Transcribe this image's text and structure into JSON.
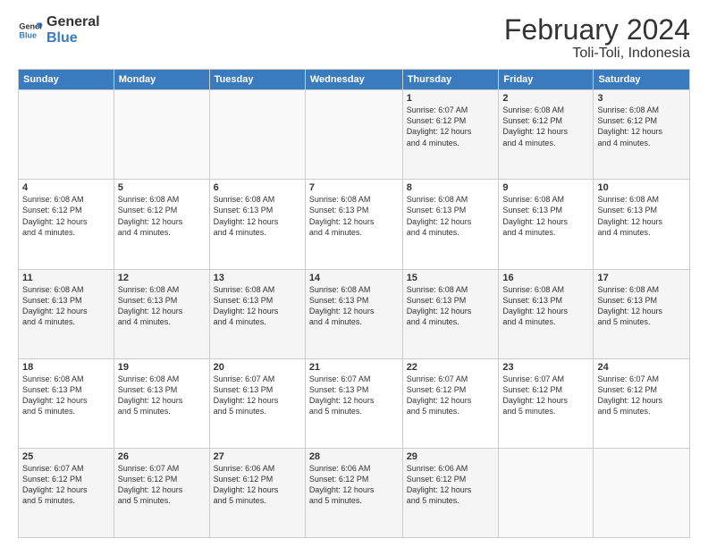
{
  "logo": {
    "line1": "General",
    "line2": "Blue"
  },
  "title": "February 2024",
  "subtitle": "Toli-Toli, Indonesia",
  "header_days": [
    "Sunday",
    "Monday",
    "Tuesday",
    "Wednesday",
    "Thursday",
    "Friday",
    "Saturday"
  ],
  "weeks": [
    [
      {
        "day": "",
        "info": ""
      },
      {
        "day": "",
        "info": ""
      },
      {
        "day": "",
        "info": ""
      },
      {
        "day": "",
        "info": ""
      },
      {
        "day": "1",
        "info": "Sunrise: 6:07 AM\nSunset: 6:12 PM\nDaylight: 12 hours\nand 4 minutes."
      },
      {
        "day": "2",
        "info": "Sunrise: 6:08 AM\nSunset: 6:12 PM\nDaylight: 12 hours\nand 4 minutes."
      },
      {
        "day": "3",
        "info": "Sunrise: 6:08 AM\nSunset: 6:12 PM\nDaylight: 12 hours\nand 4 minutes."
      }
    ],
    [
      {
        "day": "4",
        "info": "Sunrise: 6:08 AM\nSunset: 6:12 PM\nDaylight: 12 hours\nand 4 minutes."
      },
      {
        "day": "5",
        "info": "Sunrise: 6:08 AM\nSunset: 6:12 PM\nDaylight: 12 hours\nand 4 minutes."
      },
      {
        "day": "6",
        "info": "Sunrise: 6:08 AM\nSunset: 6:13 PM\nDaylight: 12 hours\nand 4 minutes."
      },
      {
        "day": "7",
        "info": "Sunrise: 6:08 AM\nSunset: 6:13 PM\nDaylight: 12 hours\nand 4 minutes."
      },
      {
        "day": "8",
        "info": "Sunrise: 6:08 AM\nSunset: 6:13 PM\nDaylight: 12 hours\nand 4 minutes."
      },
      {
        "day": "9",
        "info": "Sunrise: 6:08 AM\nSunset: 6:13 PM\nDaylight: 12 hours\nand 4 minutes."
      },
      {
        "day": "10",
        "info": "Sunrise: 6:08 AM\nSunset: 6:13 PM\nDaylight: 12 hours\nand 4 minutes."
      }
    ],
    [
      {
        "day": "11",
        "info": "Sunrise: 6:08 AM\nSunset: 6:13 PM\nDaylight: 12 hours\nand 4 minutes."
      },
      {
        "day": "12",
        "info": "Sunrise: 6:08 AM\nSunset: 6:13 PM\nDaylight: 12 hours\nand 4 minutes."
      },
      {
        "day": "13",
        "info": "Sunrise: 6:08 AM\nSunset: 6:13 PM\nDaylight: 12 hours\nand 4 minutes."
      },
      {
        "day": "14",
        "info": "Sunrise: 6:08 AM\nSunset: 6:13 PM\nDaylight: 12 hours\nand 4 minutes."
      },
      {
        "day": "15",
        "info": "Sunrise: 6:08 AM\nSunset: 6:13 PM\nDaylight: 12 hours\nand 4 minutes."
      },
      {
        "day": "16",
        "info": "Sunrise: 6:08 AM\nSunset: 6:13 PM\nDaylight: 12 hours\nand 4 minutes."
      },
      {
        "day": "17",
        "info": "Sunrise: 6:08 AM\nSunset: 6:13 PM\nDaylight: 12 hours\nand 5 minutes."
      }
    ],
    [
      {
        "day": "18",
        "info": "Sunrise: 6:08 AM\nSunset: 6:13 PM\nDaylight: 12 hours\nand 5 minutes."
      },
      {
        "day": "19",
        "info": "Sunrise: 6:08 AM\nSunset: 6:13 PM\nDaylight: 12 hours\nand 5 minutes."
      },
      {
        "day": "20",
        "info": "Sunrise: 6:07 AM\nSunset: 6:13 PM\nDaylight: 12 hours\nand 5 minutes."
      },
      {
        "day": "21",
        "info": "Sunrise: 6:07 AM\nSunset: 6:13 PM\nDaylight: 12 hours\nand 5 minutes."
      },
      {
        "day": "22",
        "info": "Sunrise: 6:07 AM\nSunset: 6:12 PM\nDaylight: 12 hours\nand 5 minutes."
      },
      {
        "day": "23",
        "info": "Sunrise: 6:07 AM\nSunset: 6:12 PM\nDaylight: 12 hours\nand 5 minutes."
      },
      {
        "day": "24",
        "info": "Sunrise: 6:07 AM\nSunset: 6:12 PM\nDaylight: 12 hours\nand 5 minutes."
      }
    ],
    [
      {
        "day": "25",
        "info": "Sunrise: 6:07 AM\nSunset: 6:12 PM\nDaylight: 12 hours\nand 5 minutes."
      },
      {
        "day": "26",
        "info": "Sunrise: 6:07 AM\nSunset: 6:12 PM\nDaylight: 12 hours\nand 5 minutes."
      },
      {
        "day": "27",
        "info": "Sunrise: 6:06 AM\nSunset: 6:12 PM\nDaylight: 12 hours\nand 5 minutes."
      },
      {
        "day": "28",
        "info": "Sunrise: 6:06 AM\nSunset: 6:12 PM\nDaylight: 12 hours\nand 5 minutes."
      },
      {
        "day": "29",
        "info": "Sunrise: 6:06 AM\nSunset: 6:12 PM\nDaylight: 12 hours\nand 5 minutes."
      },
      {
        "day": "",
        "info": ""
      },
      {
        "day": "",
        "info": ""
      }
    ]
  ]
}
